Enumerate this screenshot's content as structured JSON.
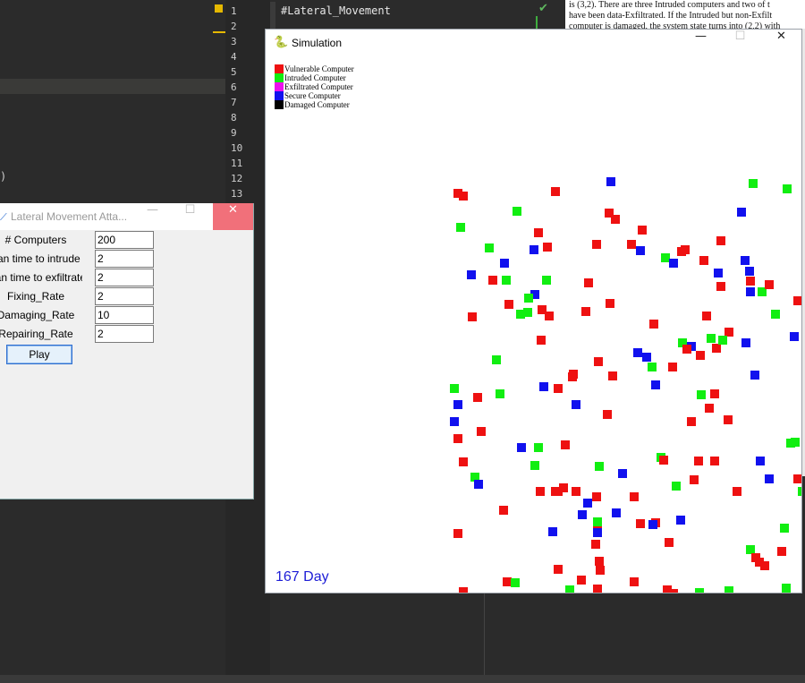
{
  "ide": {
    "code_line": "#Lateral_Movement",
    "line_numbers": [
      "1",
      "2",
      "3",
      "4",
      "5",
      "6",
      "7",
      "8",
      "9",
      "10",
      "11",
      "12",
      "13"
    ],
    "left_text": ")",
    "doc_line1": "is (3,2). There are three Intruded computers and two of t",
    "doc_line2": "have been data-Exfiltrated. If the Intruded but non-Exfilt",
    "doc_line3": "computer is damaged, the system state turns into (2,2) with"
  },
  "form": {
    "title": "Lateral Movement Atta...",
    "fields": [
      {
        "label": "# Computers",
        "value": "200"
      },
      {
        "label": "ean time to intrude",
        "value": "2"
      },
      {
        "label": "ean time to exfiltrate",
        "value": "2"
      },
      {
        "label": "Fixing_Rate",
        "value": "2"
      },
      {
        "label": "Damaging_Rate",
        "value": "10"
      },
      {
        "label": "Repairing_Rate",
        "value": "2"
      }
    ],
    "play_label": "Play"
  },
  "sim": {
    "title": "Simulation",
    "day_label": "167 Day",
    "colors": {
      "vulnerable": "#ee1111",
      "intruded": "#11ee11",
      "exfiltrated": "#ee11ee",
      "secure": "#1111ee",
      "damaged": "#000000"
    },
    "legend": [
      {
        "label": "Vulnerable Computer",
        "state": "vulnerable"
      },
      {
        "label": "Intruded Computer",
        "state": "intruded"
      },
      {
        "label": "Exfiltrated Computer",
        "state": "exfiltrated"
      },
      {
        "label": "Secure Computer",
        "state": "secure"
      },
      {
        "label": "Damaged Computer",
        "state": "damaged"
      }
    ],
    "computers": [
      [
        "V",
        110,
        153
      ],
      [
        "V",
        116,
        156
      ],
      [
        "V",
        219,
        151
      ],
      [
        "S",
        281,
        140
      ],
      [
        "I",
        440,
        142
      ],
      [
        "I",
        478,
        148
      ],
      [
        "V",
        501,
        159
      ],
      [
        "S",
        534,
        152
      ],
      [
        "I",
        574,
        152
      ],
      [
        "V",
        599,
        140
      ],
      [
        "I",
        113,
        191
      ],
      [
        "I",
        176,
        173
      ],
      [
        "V",
        200,
        197
      ],
      [
        "V",
        210,
        213
      ],
      [
        "V",
        265,
        210
      ],
      [
        "V",
        279,
        175
      ],
      [
        "V",
        286,
        182
      ],
      [
        "V",
        316,
        194
      ],
      [
        "S",
        195,
        216
      ],
      [
        "I",
        145,
        214
      ],
      [
        "V",
        304,
        210
      ],
      [
        "S",
        314,
        217
      ],
      [
        "S",
        427,
        174
      ],
      [
        "V",
        404,
        206
      ],
      [
        "V",
        508,
        203
      ],
      [
        "V",
        517,
        206
      ],
      [
        "V",
        524,
        206
      ],
      [
        "S",
        524,
        198
      ],
      [
        "V",
        532,
        202
      ],
      [
        "I",
        544,
        209
      ],
      [
        "S",
        579,
        211
      ],
      [
        "V",
        591,
        183
      ],
      [
        "V",
        597,
        184
      ],
      [
        "S",
        162,
        231
      ],
      [
        "S",
        125,
        244
      ],
      [
        "V",
        149,
        250
      ],
      [
        "I",
        164,
        250
      ],
      [
        "I",
        209,
        250
      ],
      [
        "V",
        256,
        253
      ],
      [
        "I",
        342,
        225
      ],
      [
        "S",
        351,
        231
      ],
      [
        "V",
        360,
        218
      ],
      [
        "V",
        364,
        216
      ],
      [
        "V",
        385,
        228
      ],
      [
        "S",
        431,
        228
      ],
      [
        "V",
        404,
        257
      ],
      [
        "S",
        436,
        240
      ],
      [
        "S",
        401,
        242
      ],
      [
        "V",
        437,
        251
      ],
      [
        "S",
        437,
        263
      ],
      [
        "I",
        450,
        263
      ],
      [
        "V",
        458,
        255
      ],
      [
        "I",
        503,
        257
      ],
      [
        "V",
        490,
        273
      ],
      [
        "S",
        503,
        281
      ],
      [
        "V",
        536,
        262
      ],
      [
        "V",
        543,
        269
      ],
      [
        "I",
        545,
        270
      ],
      [
        "V",
        549,
        274
      ],
      [
        "I",
        522,
        271
      ],
      [
        "I",
        553,
        274
      ],
      [
        "V",
        576,
        266
      ],
      [
        "S",
        580,
        290
      ],
      [
        "V",
        594,
        237
      ],
      [
        "V",
        126,
        291
      ],
      [
        "V",
        167,
        277
      ],
      [
        "S",
        196,
        266
      ],
      [
        "I",
        189,
        270
      ],
      [
        "I",
        180,
        288
      ],
      [
        "I",
        188,
        286
      ],
      [
        "V",
        204,
        283
      ],
      [
        "V",
        212,
        290
      ],
      [
        "V",
        253,
        285
      ],
      [
        "V",
        280,
        276
      ],
      [
        "V",
        329,
        299
      ],
      [
        "V",
        388,
        290
      ],
      [
        "V",
        413,
        308
      ],
      [
        "I",
        465,
        288
      ],
      [
        "V",
        578,
        287
      ],
      [
        "S",
        311,
        331
      ],
      [
        "S",
        321,
        336
      ],
      [
        "I",
        361,
        320
      ],
      [
        "S",
        371,
        324
      ],
      [
        "V",
        366,
        327
      ],
      [
        "V",
        381,
        334
      ],
      [
        "I",
        393,
        315
      ],
      [
        "V",
        399,
        326
      ],
      [
        "I",
        406,
        317
      ],
      [
        "S",
        432,
        320
      ],
      [
        "S",
        486,
        313
      ],
      [
        "I",
        504,
        327
      ],
      [
        "V",
        563,
        342
      ],
      [
        "I",
        153,
        339
      ],
      [
        "V",
        239,
        355
      ],
      [
        "V",
        238,
        358
      ],
      [
        "V",
        267,
        341
      ],
      [
        "V",
        283,
        357
      ],
      [
        "V",
        203,
        317
      ],
      [
        "S",
        331,
        367
      ],
      [
        "S",
        206,
        369
      ],
      [
        "V",
        222,
        371
      ],
      [
        "I",
        327,
        347
      ],
      [
        "V",
        350,
        347
      ],
      [
        "V",
        537,
        357
      ],
      [
        "V",
        543,
        362
      ],
      [
        "V",
        132,
        381
      ],
      [
        "S",
        110,
        389
      ],
      [
        "I",
        106,
        371
      ],
      [
        "I",
        157,
        377
      ],
      [
        "S",
        106,
        408
      ],
      [
        "V",
        110,
        427
      ],
      [
        "V",
        136,
        419
      ],
      [
        "S",
        242,
        389
      ],
      [
        "V",
        277,
        400
      ],
      [
        "I",
        382,
        378
      ],
      [
        "V",
        397,
        377
      ],
      [
        "V",
        391,
        393
      ],
      [
        "V",
        371,
        408
      ],
      [
        "V",
        412,
        406
      ],
      [
        "S",
        530,
        386
      ],
      [
        "V",
        546,
        386
      ],
      [
        "S",
        442,
        356
      ],
      [
        "V",
        528,
        409
      ],
      [
        "V",
        535,
        419
      ],
      [
        "V",
        539,
        433
      ],
      [
        "I",
        482,
        432
      ],
      [
        "I",
        487,
        431
      ],
      [
        "V",
        503,
        446
      ],
      [
        "S",
        560,
        416
      ],
      [
        "S",
        181,
        437
      ],
      [
        "I",
        200,
        437
      ],
      [
        "V",
        230,
        434
      ],
      [
        "V",
        116,
        453
      ],
      [
        "I",
        196,
        457
      ],
      [
        "I",
        268,
        458
      ],
      [
        "S",
        294,
        466
      ],
      [
        "I",
        337,
        448
      ],
      [
        "V",
        340,
        451
      ],
      [
        "V",
        379,
        452
      ],
      [
        "V",
        397,
        452
      ],
      [
        "S",
        448,
        452
      ],
      [
        "I",
        129,
        470
      ],
      [
        "S",
        133,
        478
      ],
      [
        "V",
        202,
        486
      ],
      [
        "V",
        219,
        486
      ],
      [
        "V",
        228,
        482
      ],
      [
        "V",
        242,
        486
      ],
      [
        "V",
        222,
        486
      ],
      [
        "V",
        265,
        492
      ],
      [
        "V",
        307,
        492
      ],
      [
        "I",
        354,
        480
      ],
      [
        "V",
        374,
        473
      ],
      [
        "V",
        422,
        486
      ],
      [
        "S",
        458,
        472
      ],
      [
        "V",
        490,
        472
      ],
      [
        "I",
        495,
        486
      ],
      [
        "V",
        528,
        474
      ],
      [
        "S",
        560,
        467
      ],
      [
        "V",
        594,
        470
      ],
      [
        "S",
        598,
        491
      ],
      [
        "S",
        255,
        499
      ],
      [
        "V",
        161,
        507
      ],
      [
        "S",
        249,
        512
      ],
      [
        "S",
        287,
        510
      ],
      [
        "V",
        314,
        522
      ],
      [
        "V",
        331,
        521
      ],
      [
        "S",
        328,
        523
      ],
      [
        "I",
        266,
        520
      ],
      [
        "V",
        266,
        530
      ],
      [
        "S",
        359,
        518
      ],
      [
        "V",
        518,
        506
      ],
      [
        "V",
        568,
        518
      ],
      [
        "S",
        266,
        532
      ],
      [
        "S",
        216,
        531
      ],
      [
        "V",
        110,
        533
      ],
      [
        "V",
        264,
        545
      ],
      [
        "V",
        346,
        543
      ],
      [
        "I",
        475,
        527
      ],
      [
        "V",
        565,
        540
      ],
      [
        "V",
        472,
        553
      ],
      [
        "I",
        437,
        551
      ],
      [
        "V",
        443,
        560
      ],
      [
        "V",
        447,
        565
      ],
      [
        "V",
        453,
        569
      ],
      [
        "I",
        586,
        553
      ],
      [
        "V",
        222,
        573
      ],
      [
        "V",
        268,
        564
      ],
      [
        "V",
        269,
        574
      ],
      [
        "V",
        248,
        585
      ],
      [
        "V",
        307,
        587
      ],
      [
        "V",
        165,
        587
      ],
      [
        "I",
        174,
        588
      ],
      [
        "V",
        116,
        598
      ],
      [
        "I",
        235,
        596
      ],
      [
        "V",
        266,
        595
      ],
      [
        "V",
        344,
        596
      ],
      [
        "V",
        351,
        600
      ],
      [
        "I",
        380,
        599
      ],
      [
        "I",
        413,
        597
      ],
      [
        "I",
        477,
        594
      ],
      [
        "I",
        290,
        613
      ],
      [
        "I",
        323,
        616
      ]
    ]
  }
}
